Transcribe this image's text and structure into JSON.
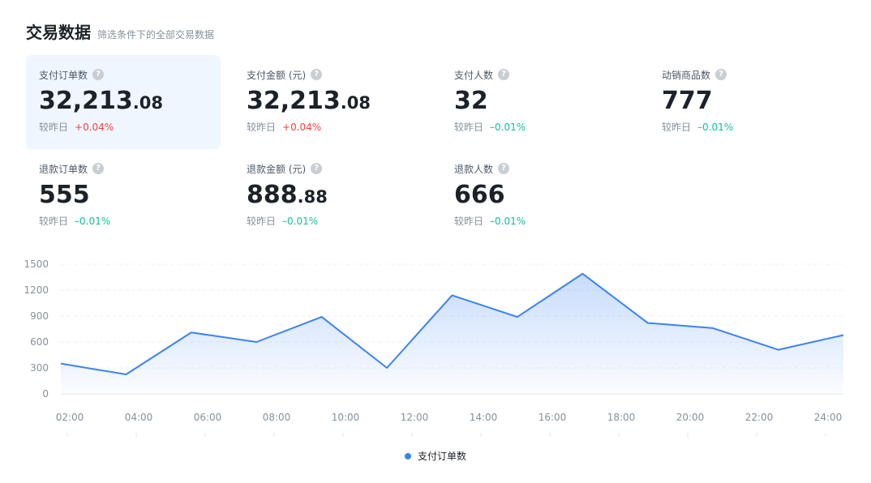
{
  "header": {
    "title": "交易数据",
    "subtitle": "筛选条件下的全部交易数据"
  },
  "metrics": [
    {
      "label": "支付订单数",
      "int": "32,213",
      "dec": ".08",
      "compare": "较昨日",
      "delta": "+0.04%",
      "trend": "up",
      "active": true
    },
    {
      "label": "支付金额 (元)",
      "int": "32,213",
      "dec": ".08",
      "compare": "较昨日",
      "delta": "+0.04%",
      "trend": "up"
    },
    {
      "label": "支付人数",
      "int": "32",
      "dec": "",
      "compare": "较昨日",
      "delta": "–0.01%",
      "trend": "down"
    },
    {
      "label": "动销商品数",
      "int": "777",
      "dec": "",
      "compare": "较昨日",
      "delta": "–0.01%",
      "trend": "down"
    },
    {
      "label": "退款订单数",
      "int": "555",
      "dec": "",
      "compare": "较昨日",
      "delta": "–0.01%",
      "trend": "down"
    },
    {
      "label": "退款金额 (元)",
      "int": "888",
      "dec": ".88",
      "compare": "较昨日",
      "delta": "–0.01%",
      "trend": "down"
    },
    {
      "label": "退款人数",
      "int": "666",
      "dec": "",
      "compare": "较昨日",
      "delta": "–0.01%",
      "trend": "down"
    }
  ],
  "help_icon": "question-circle-icon",
  "colors": {
    "accent": "#3b82f6",
    "up": "#f53f3f",
    "down": "#0fbf9f",
    "active_card": "#f0f6ff"
  },
  "chart_data": {
    "type": "area",
    "series": [
      {
        "name": "支付订单数",
        "values": [
          350,
          225,
          710,
          600,
          890,
          300,
          1140,
          890,
          1390,
          820,
          760,
          510,
          680
        ]
      }
    ],
    "x_tick_labels": [
      "02:00",
      "04:00",
      "06:00",
      "08:00",
      "10:00",
      "12:00",
      "14:00",
      "16:00",
      "18:00",
      "20:00",
      "22:00",
      "24:00"
    ],
    "y_ticks": [
      0,
      300,
      600,
      900,
      1200,
      1500
    ],
    "ylim": [
      0,
      1500
    ],
    "grid": true,
    "legend": "bottom-center"
  }
}
